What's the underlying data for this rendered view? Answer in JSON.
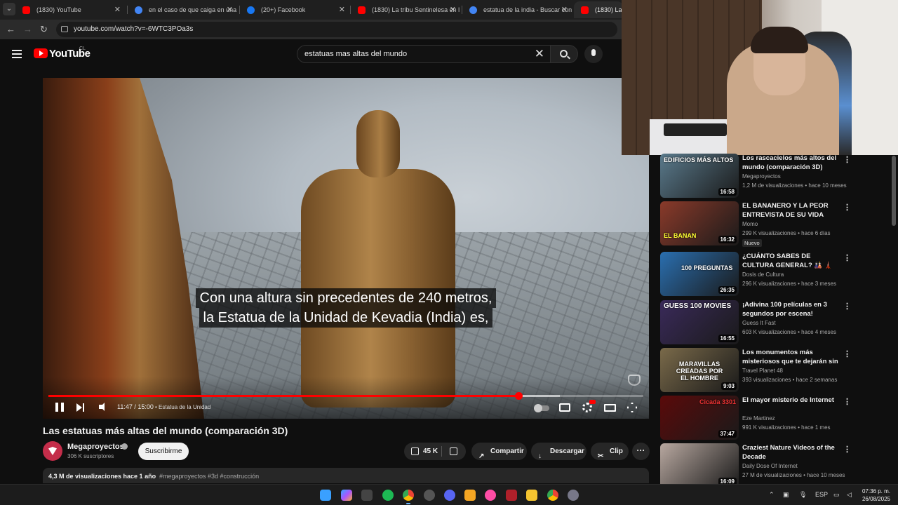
{
  "browser": {
    "tabs": [
      {
        "title": "(1830) YouTube",
        "color": "#ff0000",
        "active": false
      },
      {
        "title": "en el caso de que caiga en una",
        "color": "#4285f4",
        "active": false
      },
      {
        "title": "(20+) Facebook",
        "color": "#1877f2",
        "active": false
      },
      {
        "title": "(1830) La tribu Sentinelesa en l",
        "color": "#ff0000",
        "active": false
      },
      {
        "title": "estatua de la india - Buscar con",
        "color": "#4285f4",
        "active": false
      },
      {
        "title": "(1830) Las es",
        "color": "#ff0000",
        "active": true
      }
    ],
    "url": "youtube.com/watch?v=-6WTC3POa3s"
  },
  "youtube": {
    "logo_text": "YouTube",
    "region": "CL",
    "search_query": "estatuas mas altas del mundo"
  },
  "player": {
    "subtitles": [
      "Con una altura sin precedentes de 240 metros,",
      "la Estatua de la Unidad de Kevadia (India) es,"
    ],
    "time": "11:47 / 15:00",
    "chapter": "• Estatua de la Unidad",
    "progress_fraction": 0.79,
    "buffer_fraction": 0.86
  },
  "video": {
    "title": "Las estatuas más altas del mundo (comparación 3D)",
    "channel": "Megaproyectos",
    "subscribers": "306 K suscriptores",
    "subscribe_label": "Suscribirme",
    "likes": "45 K",
    "share_label": "Compartir",
    "download_label": "Descargar",
    "clip_label": "Clip",
    "more_label": "···",
    "views": "4,3 M de visualizaciones  hace 1 año",
    "tags": "#megaproyectos #3d #construcción"
  },
  "recommendations": [
    {
      "title": "Los rascacielos más altos del mundo (comparación 3D)",
      "channel": "Megaproyectos",
      "meta": "1,2 M de visualizaciones • hace 10 meses",
      "duration": "16:58",
      "thumb_text": "EDIFICIOS MÁS ALTOS",
      "thumb_color": "#5a7a8c",
      "badge": ""
    },
    {
      "title": "EL BANANERO Y LA PEOR ENTREVISTA DE SU VIDA",
      "channel": "Momo",
      "meta": "299 K visualizaciones • hace 6 días",
      "duration": "16:32",
      "thumb_text": "EL BANAN",
      "thumb_color": "#8a3a2a",
      "badge": "Nuevo"
    },
    {
      "title": "¿CUÁNTO SABES DE CULTURA GENERAL? 🎎 🗼 🗽 | 101 ...",
      "channel": "Dosis de Cultura",
      "meta": "296 K visualizaciones • hace 3 meses",
      "duration": "26:35",
      "thumb_text": "100 PREGUNTAS",
      "thumb_color": "#2a6fb0",
      "badge": ""
    },
    {
      "title": "¡Adivina 100 películas en 3 segundos por escena! Desafío...",
      "channel": "Guess It Fast",
      "meta": "603 K visualizaciones • hace 4 meses",
      "duration": "16:55",
      "thumb_text": "GUESS 100 MOVIES",
      "thumb_color": "#3a2a5a",
      "badge": ""
    },
    {
      "title": "Los monumentos más misteriosos que te dejarán sin ...",
      "channel": "Travel Planet 48",
      "meta": "393 visualizaciones • hace 2 semanas",
      "duration": "9:03",
      "thumb_text": "MARAVILLAS CREADAS POR EL HOMBRE",
      "thumb_color": "#7a6a4a",
      "badge": ""
    },
    {
      "title": "El mayor misterio de Internet",
      "channel": "Eze Martinez",
      "meta": "991 K visualizaciones • hace 1 mes",
      "duration": "37:47",
      "thumb_text": "Cicada 3301",
      "thumb_color": "#5a0a0a",
      "badge": ""
    },
    {
      "title": "Craziest Nature Videos of the Decade",
      "channel": "Daily Dose Of Internet",
      "meta": "27 M de visualizaciones • hace 10 meses",
      "duration": "16:09",
      "thumb_text": "",
      "thumb_color": "#b8a8a0",
      "badge": ""
    }
  ],
  "taskbar": {
    "lang": "ESP",
    "time": "07:36 p. m.",
    "date": "26/08/2025"
  }
}
